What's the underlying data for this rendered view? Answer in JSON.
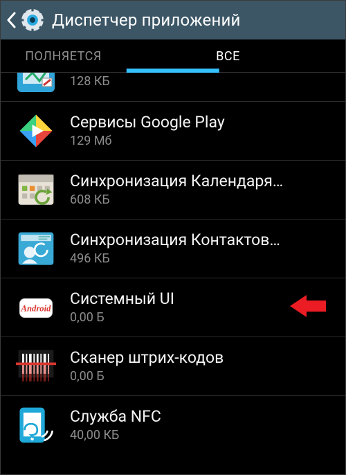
{
  "header": {
    "title": "Диспетчер приложений"
  },
  "tabs": {
    "left": "ПОЛНЯЕТСЯ",
    "right": "ВСЕ",
    "active_index": 1
  },
  "apps": [
    {
      "name": "",
      "size": "128 КБ",
      "icon": "widget"
    },
    {
      "name": "Сервисы Google Play",
      "size": "129 Мб",
      "icon": "play"
    },
    {
      "name": "Синхронизация Календаря…",
      "size": "608 КБ",
      "icon": "calendar-sync"
    },
    {
      "name": "Синхронизация Контактов…",
      "size": "496 КБ",
      "icon": "contacts-sync"
    },
    {
      "name": "Системный UI",
      "size": "0,00 Б",
      "icon": "android",
      "highlight": true
    },
    {
      "name": "Сканер штрих-кодов",
      "size": "0,00 Б",
      "icon": "barcode"
    },
    {
      "name": "Служба NFC",
      "size": "40,00 КБ",
      "icon": "nfc"
    }
  ]
}
